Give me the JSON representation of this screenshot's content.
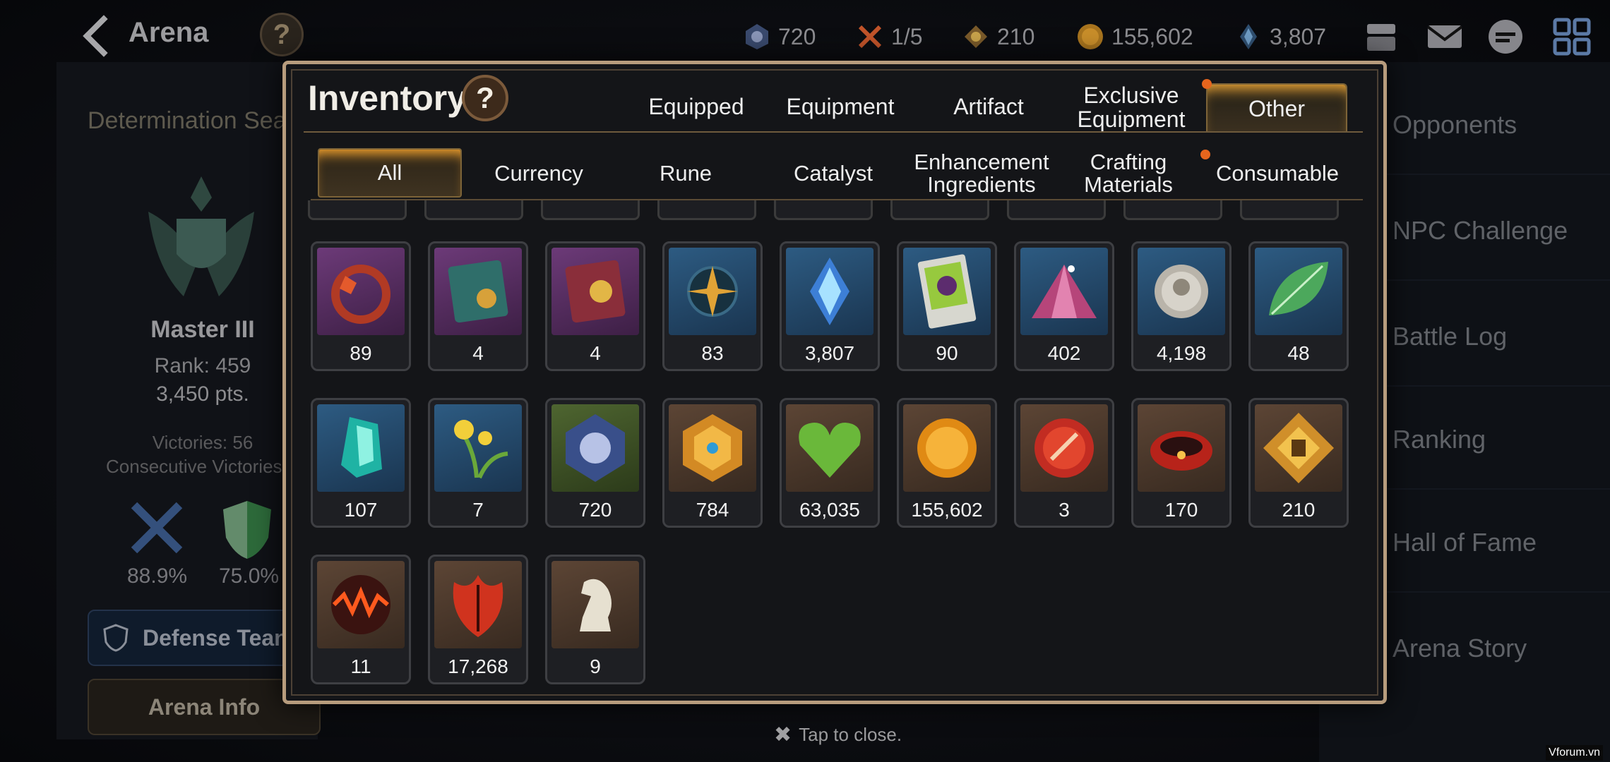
{
  "header": {
    "back_label": "Arena",
    "help": "?",
    "resources": [
      "720",
      "1/5",
      "210",
      "155,602",
      "3,807"
    ]
  },
  "left": {
    "season": "Determination Sea",
    "rank_name": "Master III",
    "rank_line": "Rank: 459",
    "points": "3,450 pts.",
    "victories": "Victories: 56",
    "consecutive": "Consecutive Victories",
    "attack_rate": "88.9%",
    "defense_rate": "75.0%",
    "defense_team": "Defense Tean",
    "arena_info": "Arena Info"
  },
  "right": {
    "items": [
      "Opponents",
      "NPC Challenge",
      "Battle Log",
      "Ranking",
      "Hall of Fame",
      "Arena Story"
    ]
  },
  "modal": {
    "title": "Inventory",
    "help": "?",
    "tabs": [
      "Equipped",
      "Equipment",
      "Artifact",
      "Exclusive\nEquipment",
      "Other"
    ],
    "subtabs": [
      "All",
      "Currency",
      "Rune",
      "Catalyst",
      "Enhancement\nIngredients",
      "Crafting\nMaterials",
      "Consumable"
    ],
    "items": [
      {
        "icon": "lamp-icon",
        "count": "89"
      },
      {
        "icon": "mystic-card-icon",
        "count": "4"
      },
      {
        "icon": "card-pack-icon",
        "count": "4"
      },
      {
        "icon": "compass-charm-icon",
        "count": "83"
      },
      {
        "icon": "crystal-icon",
        "count": "3,807"
      },
      {
        "icon": "ticket-icon",
        "count": "90"
      },
      {
        "icon": "gem-pile-icon",
        "count": "402"
      },
      {
        "icon": "silver-coin-icon",
        "count": "4,198"
      },
      {
        "icon": "leaf-icon",
        "count": "48"
      },
      {
        "icon": "cyan-crystal-icon",
        "count": "107"
      },
      {
        "icon": "flower-icon",
        "count": "7"
      },
      {
        "icon": "arena-flag-icon",
        "count": "720"
      },
      {
        "icon": "hex-badge-icon",
        "count": "784"
      },
      {
        "icon": "green-heart-icon",
        "count": "63,035"
      },
      {
        "icon": "gold-coin-icon",
        "count": "155,602"
      },
      {
        "icon": "red-cap-icon",
        "count": "3"
      },
      {
        "icon": "red-ring-icon",
        "count": "170"
      },
      {
        "icon": "conquest-badge-icon",
        "count": "210"
      },
      {
        "icon": "lava-orb-icon",
        "count": "11"
      },
      {
        "icon": "red-leaf-icon",
        "count": "17,268"
      },
      {
        "icon": "knight-piece-icon",
        "count": "9"
      }
    ]
  },
  "footer": {
    "tap_close": "Tap to close.",
    "watermark": "Vforum.vn"
  }
}
